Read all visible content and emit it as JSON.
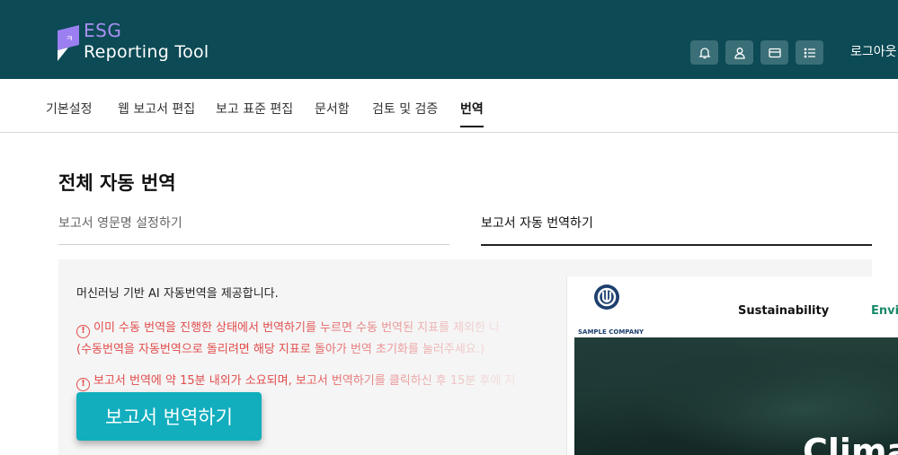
{
  "header": {
    "logo_line1": "ESG",
    "logo_line2": "Reporting Tool",
    "icons": [
      "bell-icon",
      "user-icon",
      "card-icon",
      "list-icon"
    ],
    "logout_label": "로그아웃",
    "bg_color": "#0c4a55"
  },
  "nav": {
    "tabs": [
      {
        "label": "기본설정"
      },
      {
        "label": "웹 보고서 편집"
      },
      {
        "label": "보고 표준 편집"
      },
      {
        "label": "문서함"
      },
      {
        "label": "검토 및 검증"
      },
      {
        "label": "번역"
      }
    ],
    "active_index": 5
  },
  "page": {
    "title": "전체 자동 번역",
    "subtabs": [
      {
        "label": "보고서 영문명 설정하기"
      },
      {
        "label": "보고서 자동 번역하기"
      }
    ]
  },
  "panel": {
    "intro": "머신러닝 기반 AI 자동번역을 제공합니다.",
    "warning1_line1": "이미 수동 번역을 진행한 상태에서 번역하기를 누르면 수동 번역된 지표를 제외한 나",
    "warning1_line2": "(수동번역을 자동번역으로 돌리려면 해당 지표로 돌아가 번역 초기화를 눌러주세요.)",
    "warning2": "보고서 번역에 약 15분 내외가 소요되며, 보고서 번역하기를 클릭하신 후 15분 후에 저",
    "warning_icon": "!",
    "button_label": "보고서 번역하기",
    "accent_color": "#12aebe",
    "warning_color": "#e24b4b"
  },
  "preview": {
    "company": "SAMPLE COMPANY",
    "nav1": "Sustainability",
    "nav2": "Envi",
    "hero_text": "Climat"
  }
}
